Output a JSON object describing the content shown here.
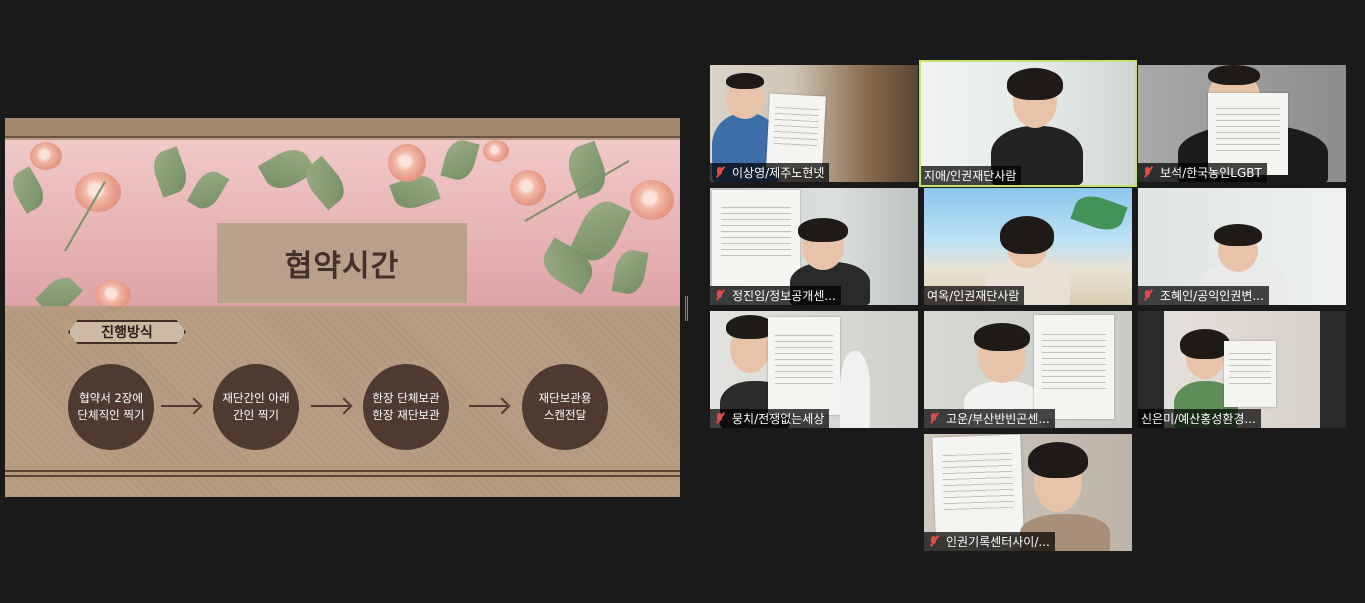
{
  "slide": {
    "title": "협약시간",
    "tag_label": "진행방식",
    "steps": [
      {
        "line1": "협약서 2장에",
        "line2": "단체직인 찍기"
      },
      {
        "line1": "재단간인 아래",
        "line2": "간인 찍기"
      },
      {
        "line1": "한장 단체보관",
        "line2": "한장 재단보관"
      },
      {
        "line1": "재단보관용",
        "line2": "스캔전달"
      }
    ]
  },
  "colors": {
    "active_speaker_border": "#c4e36a",
    "muted_icon": "#e24a4a",
    "slide_circle": "#4e3a31"
  },
  "participants": [
    {
      "name": "이상영/제주노현넷",
      "muted": true,
      "active": false
    },
    {
      "name": "지애/인권재단사람",
      "muted": false,
      "active": true
    },
    {
      "name": "보석/한국농인LGBT",
      "muted": true,
      "active": false
    },
    {
      "name": "정진임/정보공개센...",
      "muted": true,
      "active": false
    },
    {
      "name": "여옥/인권재단사람",
      "muted": false,
      "active": false
    },
    {
      "name": "조혜인/공익인권변...",
      "muted": true,
      "active": false
    },
    {
      "name": "뭉치/전쟁없는세상",
      "muted": true,
      "active": false
    },
    {
      "name": "고운/부산반빈곤센...",
      "muted": true,
      "active": false
    },
    {
      "name": "신은미/예산홍성환경...",
      "muted": false,
      "active": false
    },
    {
      "name": "인권기록센터사이/...",
      "muted": true,
      "active": false
    }
  ]
}
